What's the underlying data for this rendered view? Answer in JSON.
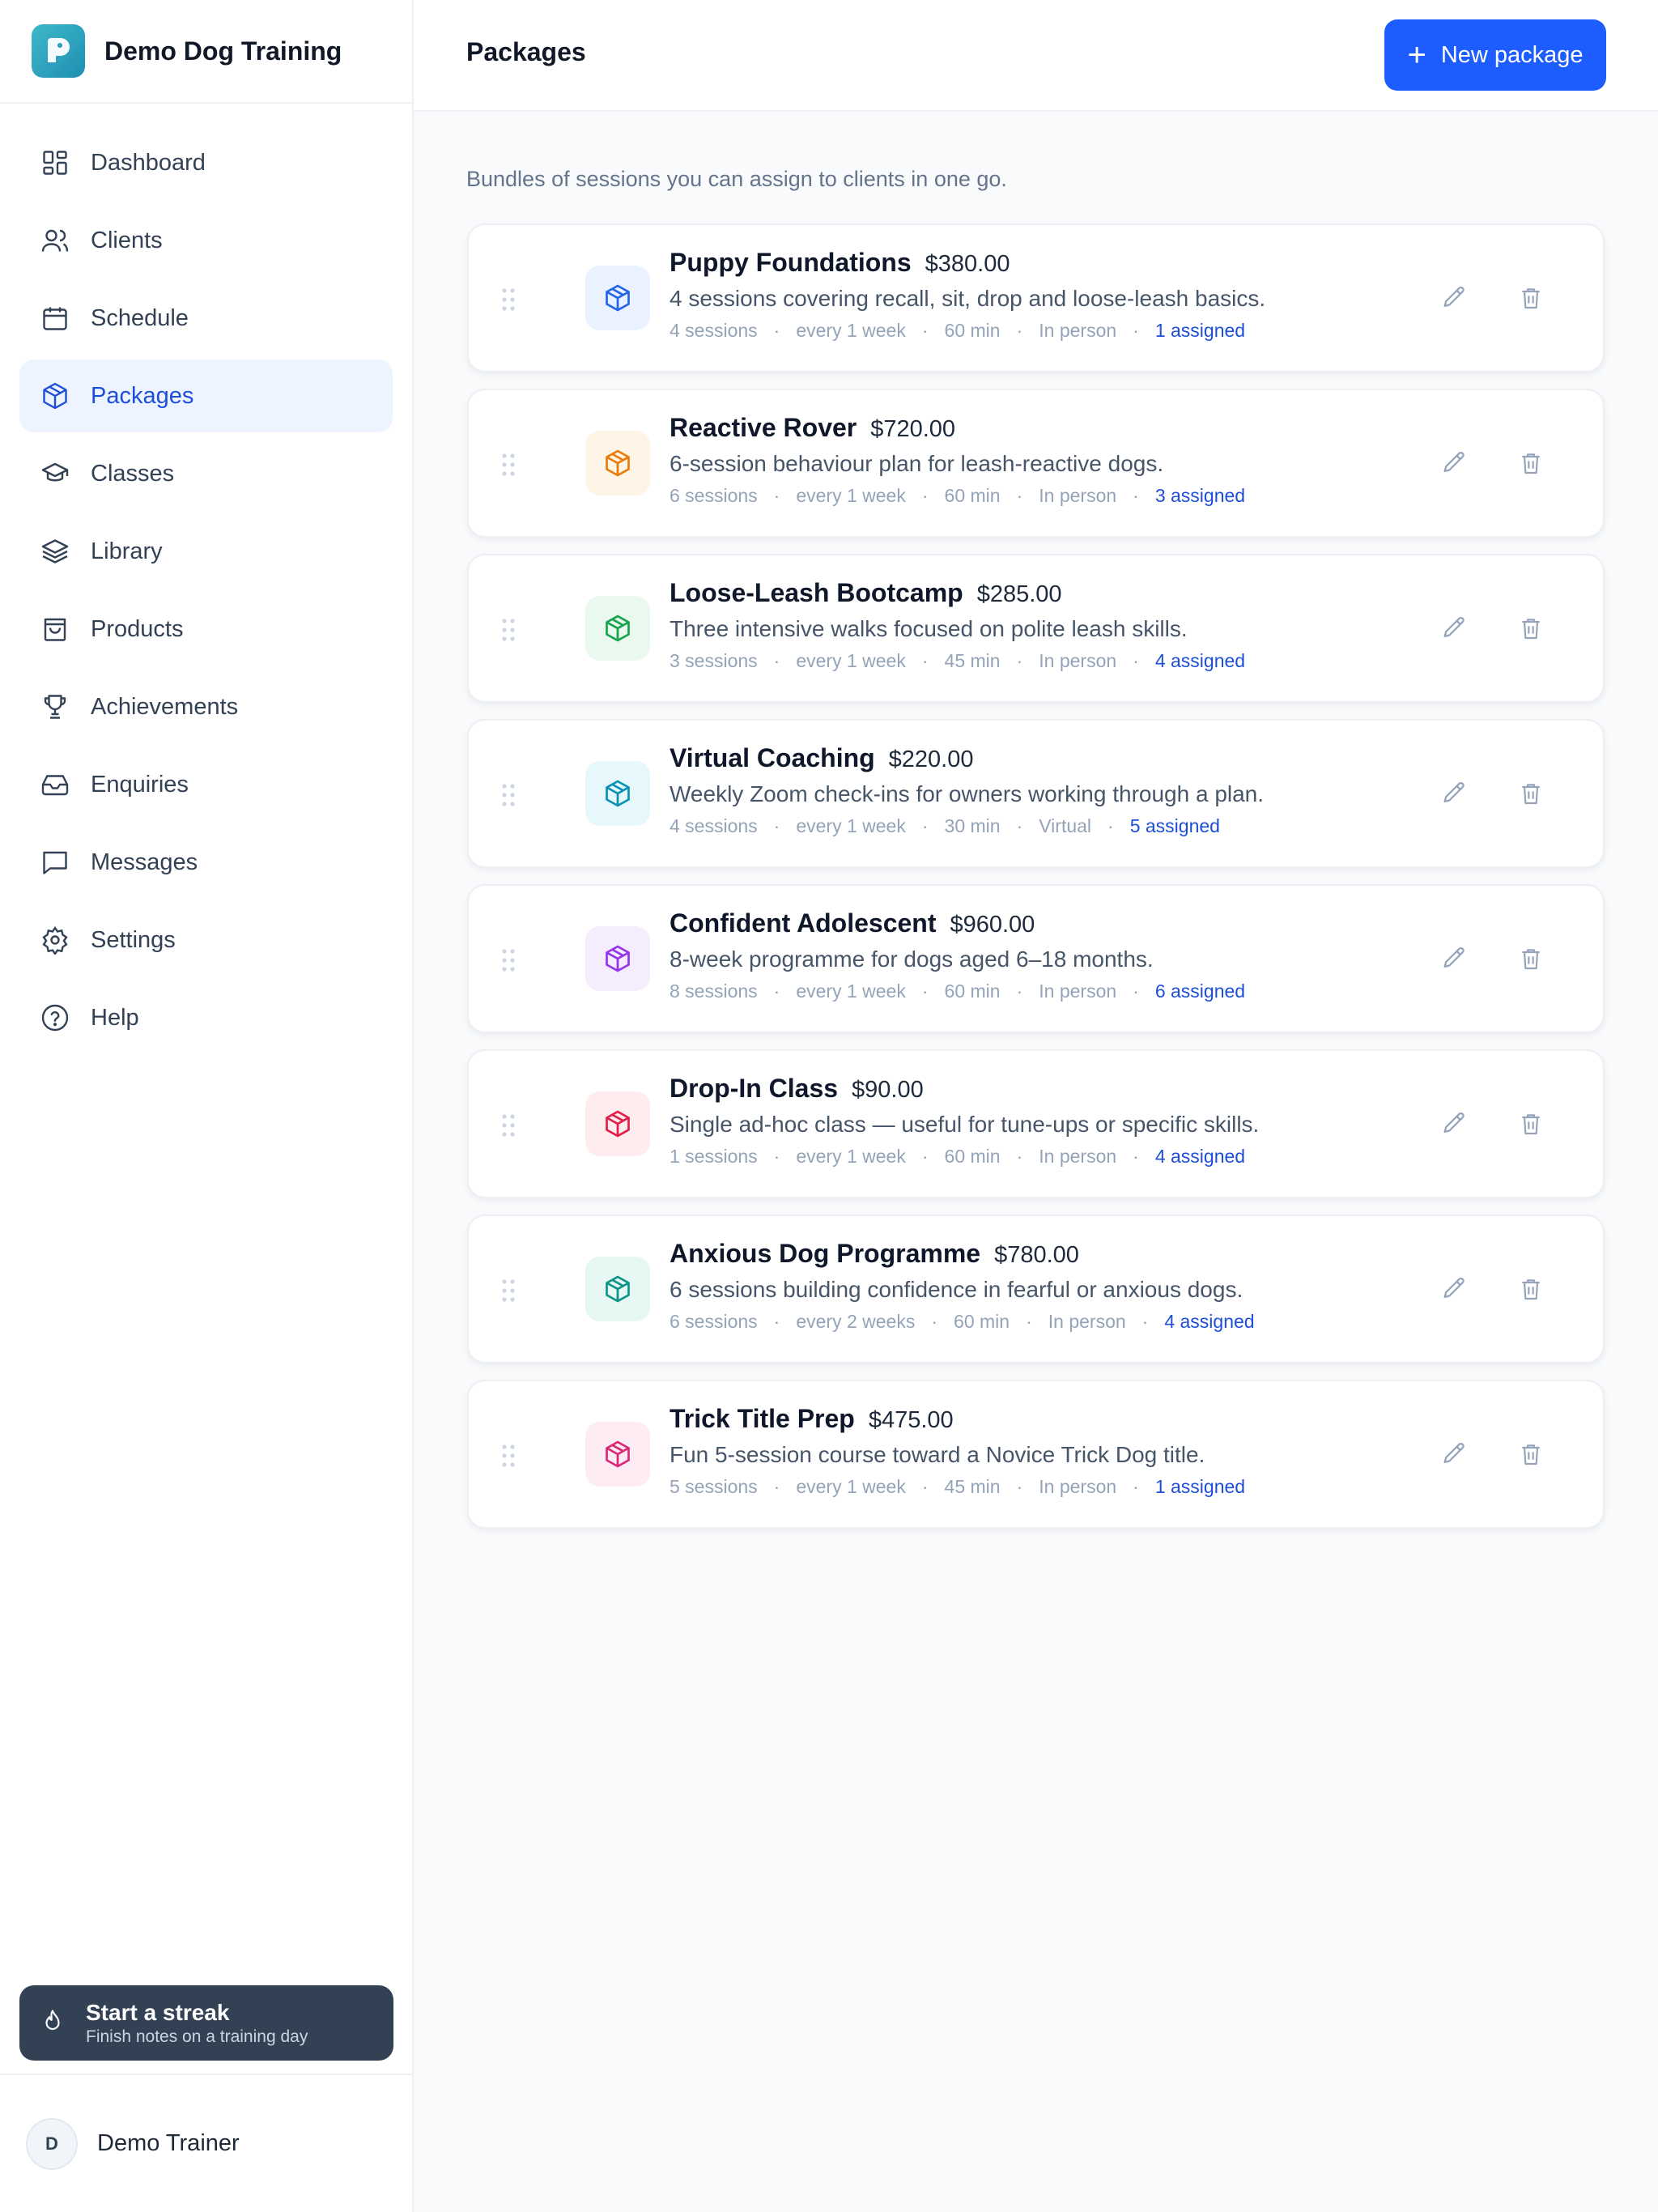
{
  "app": {
    "name": "Demo Dog Training"
  },
  "sidebar": {
    "items": [
      {
        "label": "Dashboard",
        "icon": "dashboard-icon"
      },
      {
        "label": "Clients",
        "icon": "users-icon"
      },
      {
        "label": "Schedule",
        "icon": "calendar-icon"
      },
      {
        "label": "Packages",
        "icon": "package-icon",
        "active": true
      },
      {
        "label": "Classes",
        "icon": "graduation-cap-icon"
      },
      {
        "label": "Library",
        "icon": "layers-icon"
      },
      {
        "label": "Products",
        "icon": "shopping-bag-icon"
      },
      {
        "label": "Achievements",
        "icon": "trophy-icon"
      },
      {
        "label": "Enquiries",
        "icon": "inbox-icon"
      },
      {
        "label": "Messages",
        "icon": "message-icon"
      },
      {
        "label": "Settings",
        "icon": "gear-icon"
      },
      {
        "label": "Help",
        "icon": "help-circle-icon"
      }
    ],
    "streak": {
      "title": "Start a streak",
      "subtitle": "Finish notes on a training day"
    },
    "user": {
      "initial": "D",
      "name": "Demo Trainer"
    }
  },
  "header": {
    "title": "Packages",
    "new_button": "New package"
  },
  "main": {
    "subtitle": "Bundles of sessions you can assign to clients in one go.",
    "packages": [
      {
        "name": "Puppy Foundations",
        "price": "$380.00",
        "description": "4 sessions covering recall, sit, drop and loose-leash basics.",
        "sessions": "4 sessions",
        "frequency": "every 1 week",
        "duration": "60 min",
        "mode": "In person",
        "assigned": "1 assigned",
        "color": "#2563eb",
        "bg": "#eaf2ff"
      },
      {
        "name": "Reactive Rover",
        "price": "$720.00",
        "description": "6-session behaviour plan for leash-reactive dogs.",
        "sessions": "6 sessions",
        "frequency": "every 1 week",
        "duration": "60 min",
        "mode": "In person",
        "assigned": "3 assigned",
        "color": "#ea7a0c",
        "bg": "#fff5e6"
      },
      {
        "name": "Loose-Leash Bootcamp",
        "price": "$285.00",
        "description": "Three intensive walks focused on polite leash skills.",
        "sessions": "3 sessions",
        "frequency": "every 1 week",
        "duration": "45 min",
        "mode": "In person",
        "assigned": "4 assigned",
        "color": "#16a34a",
        "bg": "#e9f9ef"
      },
      {
        "name": "Virtual Coaching",
        "price": "$220.00",
        "description": "Weekly Zoom check-ins for owners working through a plan.",
        "sessions": "4 sessions",
        "frequency": "every 1 week",
        "duration": "30 min",
        "mode": "Virtual",
        "assigned": "5 assigned",
        "color": "#0891b2",
        "bg": "#e6f8fb"
      },
      {
        "name": "Confident Adolescent",
        "price": "$960.00",
        "description": "8-week programme for dogs aged 6–18 months.",
        "sessions": "8 sessions",
        "frequency": "every 1 week",
        "duration": "60 min",
        "mode": "In person",
        "assigned": "6 assigned",
        "color": "#9333ea",
        "bg": "#f5ecfe"
      },
      {
        "name": "Drop-In Class",
        "price": "$90.00",
        "description": "Single ad-hoc class — useful for tune-ups or specific skills.",
        "sessions": "1 sessions",
        "frequency": "every 1 week",
        "duration": "60 min",
        "mode": "In person",
        "assigned": "4 assigned",
        "color": "#e11d48",
        "bg": "#feecef"
      },
      {
        "name": "Anxious Dog Programme",
        "price": "$780.00",
        "description": "6 sessions building confidence in fearful or anxious dogs.",
        "sessions": "6 sessions",
        "frequency": "every 2 weeks",
        "duration": "60 min",
        "mode": "In person",
        "assigned": "4 assigned",
        "color": "#0d9488",
        "bg": "#e6f7f4"
      },
      {
        "name": "Trick Title Prep",
        "price": "$475.00",
        "description": "Fun 5-session course toward a Novice Trick Dog title.",
        "sessions": "5 sessions",
        "frequency": "every 1 week",
        "duration": "45 min",
        "mode": "In person",
        "assigned": "1 assigned",
        "color": "#db2777",
        "bg": "#fdecf4"
      }
    ]
  }
}
